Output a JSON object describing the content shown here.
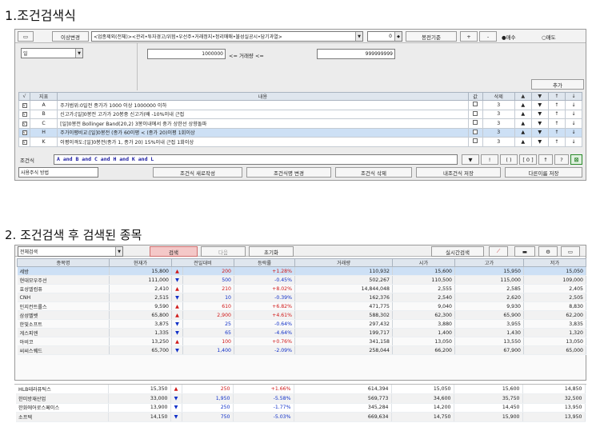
{
  "section1": {
    "title": "1.조건검색식"
  },
  "section2": {
    "title": "2. 조건검색 후 검색된 종목"
  },
  "cond_toolbar": {
    "edit_label": "이상변경",
    "filter_text": "<업종제외(전체)><관리•투자경고/위험•우선주•거래정지•정리매매•불성실공시•담기과열>",
    "count_value": "0",
    "reference_label": "봉전기준",
    "plus_label": "+",
    "minus_label": "-",
    "buy_label": "●매수",
    "sell_label": "○매도"
  },
  "cond_params": {
    "period_value": "일",
    "min_value": "1000000",
    "range_label": "<= 거래량 <=",
    "max_value": "999999999",
    "add_label": "추가"
  },
  "cond_table": {
    "headers": [
      "√",
      "지표",
      "내용",
      "값",
      "삭제",
      "▲",
      "▼",
      "↑",
      "↓"
    ],
    "rows": [
      {
        "check": "√",
        "id": "A",
        "content": "주가범위:0일전 종가가 1000 이상 1000000 이하",
        "val": "",
        "del": "3",
        "selected": false
      },
      {
        "check": "√",
        "id": "B",
        "content": "신고가:[일]0봉전 고가가 20봉중 신고가(배 -10%이내 근접",
        "val": "",
        "del": "3",
        "selected": false
      },
      {
        "check": "√",
        "id": "C",
        "content": "[일]0봉전 Bollinger Band(20,2) 3봉이내에서 중가 상한선 상향돌파",
        "val": "",
        "del": "3",
        "selected": false
      },
      {
        "check": "√",
        "id": "H",
        "content": "주가이평비교:[일]0봉전 (종가 60이평 < (종가 20)이평 1회이상",
        "val": "",
        "del": "3",
        "selected": true
      },
      {
        "check": "√",
        "id": "K",
        "content": "이평이격도:[일]0봉전(종가 1, 종가 20) 15%이내 근접 1회이상",
        "val": "",
        "del": "3",
        "selected": false
      }
    ]
  },
  "logic": {
    "label": "조건식",
    "expression": "A and B and C and H and K and L",
    "buttons": [
      "▼",
      "!",
      "( )",
      "[ 0 ]",
      "↑",
      "?"
    ]
  },
  "bottom_bar": {
    "method_label": "사용주식 방법",
    "buttons": [
      "조건식 새로작성",
      "조건식명 변경",
      "조건식 삭제",
      "내조건식 저장",
      "다른이름 저장"
    ]
  },
  "result_toolbar": {
    "scope_value": "전체검색",
    "search_label": "검색",
    "next_label": "다음",
    "reset_label": "초기화",
    "realtime_label": "실시간검색"
  },
  "result_table": {
    "headers": [
      "종목명",
      "현재가",
      "",
      "전일대비",
      "등락률",
      "거래량",
      "시가",
      "고가",
      "저가"
    ],
    "rows": [
      {
        "name": "세방",
        "price": "15,800",
        "dir": "up",
        "change": "200",
        "rate": "+1.28%",
        "volume": "110,932",
        "open": "15,600",
        "high": "15,950",
        "low": "15,050",
        "selected": true
      },
      {
        "name": "현대모우주선",
        "price": "111,000",
        "dir": "dn",
        "change": "500",
        "rate": "-0.45%",
        "volume": "502,267",
        "open": "110,500",
        "high": "115,000",
        "low": "109,000",
        "selected": false
      },
      {
        "name": "효성엘컴퓨",
        "price": "2,410",
        "dir": "up",
        "change": "210",
        "rate": "+8.02%",
        "volume": "14,844,048",
        "open": "2,555",
        "high": "2,585",
        "low": "2,405",
        "selected": false
      },
      {
        "name": "CNH",
        "price": "2,515",
        "dir": "dn",
        "change": "10",
        "rate": "-0.39%",
        "volume": "162,376",
        "open": "2,540",
        "high": "2,620",
        "low": "2,505",
        "selected": false
      },
      {
        "name": "인지컨트롤스",
        "price": "9,590",
        "dir": "up",
        "change": "610",
        "rate": "+6.82%",
        "volume": "471,775",
        "open": "9,040",
        "high": "9,930",
        "low": "8,830",
        "selected": false
      },
      {
        "name": "삼성벨벳",
        "price": "65,800",
        "dir": "up",
        "change": "2,900",
        "rate": "+4.61%",
        "volume": "588,302",
        "open": "62,300",
        "high": "65,900",
        "low": "62,200",
        "selected": false
      },
      {
        "name": "한빛소프트",
        "price": "3,875",
        "dir": "dn",
        "change": "25",
        "rate": "-0.64%",
        "volume": "297,432",
        "open": "3,880",
        "high": "3,955",
        "low": "3,835",
        "selected": false
      },
      {
        "name": "게스피엔",
        "price": "1,335",
        "dir": "dn",
        "change": "65",
        "rate": "-4.64%",
        "volume": "199,717",
        "open": "1,400",
        "high": "1,430",
        "low": "1,320",
        "selected": false
      },
      {
        "name": "아비코",
        "price": "13,250",
        "dir": "up",
        "change": "100",
        "rate": "+0.76%",
        "volume": "341,158",
        "open": "13,050",
        "high": "13,550",
        "low": "13,050",
        "selected": false
      },
      {
        "name": "씨씨스퀘드",
        "price": "65,700",
        "dir": "dn",
        "change": "1,400",
        "rate": "-2.09%",
        "volume": "258,044",
        "open": "66,200",
        "high": "67,900",
        "low": "65,000",
        "selected": false
      }
    ]
  },
  "result_table2": {
    "rows": [
      {
        "name": "HLB테라퓨틱스",
        "price": "15,350",
        "dir": "up",
        "change": "250",
        "rate": "+1.66%",
        "volume": "614,394",
        "open": "15,050",
        "high": "15,600",
        "low": "14,850"
      },
      {
        "name": "한미방재산업",
        "price": "33,000",
        "dir": "dn",
        "change": "1,950",
        "rate": "-5.58%",
        "volume": "569,773",
        "open": "34,600",
        "high": "35,750",
        "low": "32,500"
      },
      {
        "name": "한화에어로스페이스",
        "price": "13,900",
        "dir": "dn",
        "change": "250",
        "rate": "-1.77%",
        "volume": "345,284",
        "open": "14,200",
        "high": "14,450",
        "low": "13,950"
      },
      {
        "name": "소프텍",
        "price": "14,150",
        "dir": "dn",
        "change": "750",
        "rate": "-5.03%",
        "volume": "669,634",
        "open": "14,750",
        "high": "15,900",
        "low": "13,950"
      }
    ]
  }
}
